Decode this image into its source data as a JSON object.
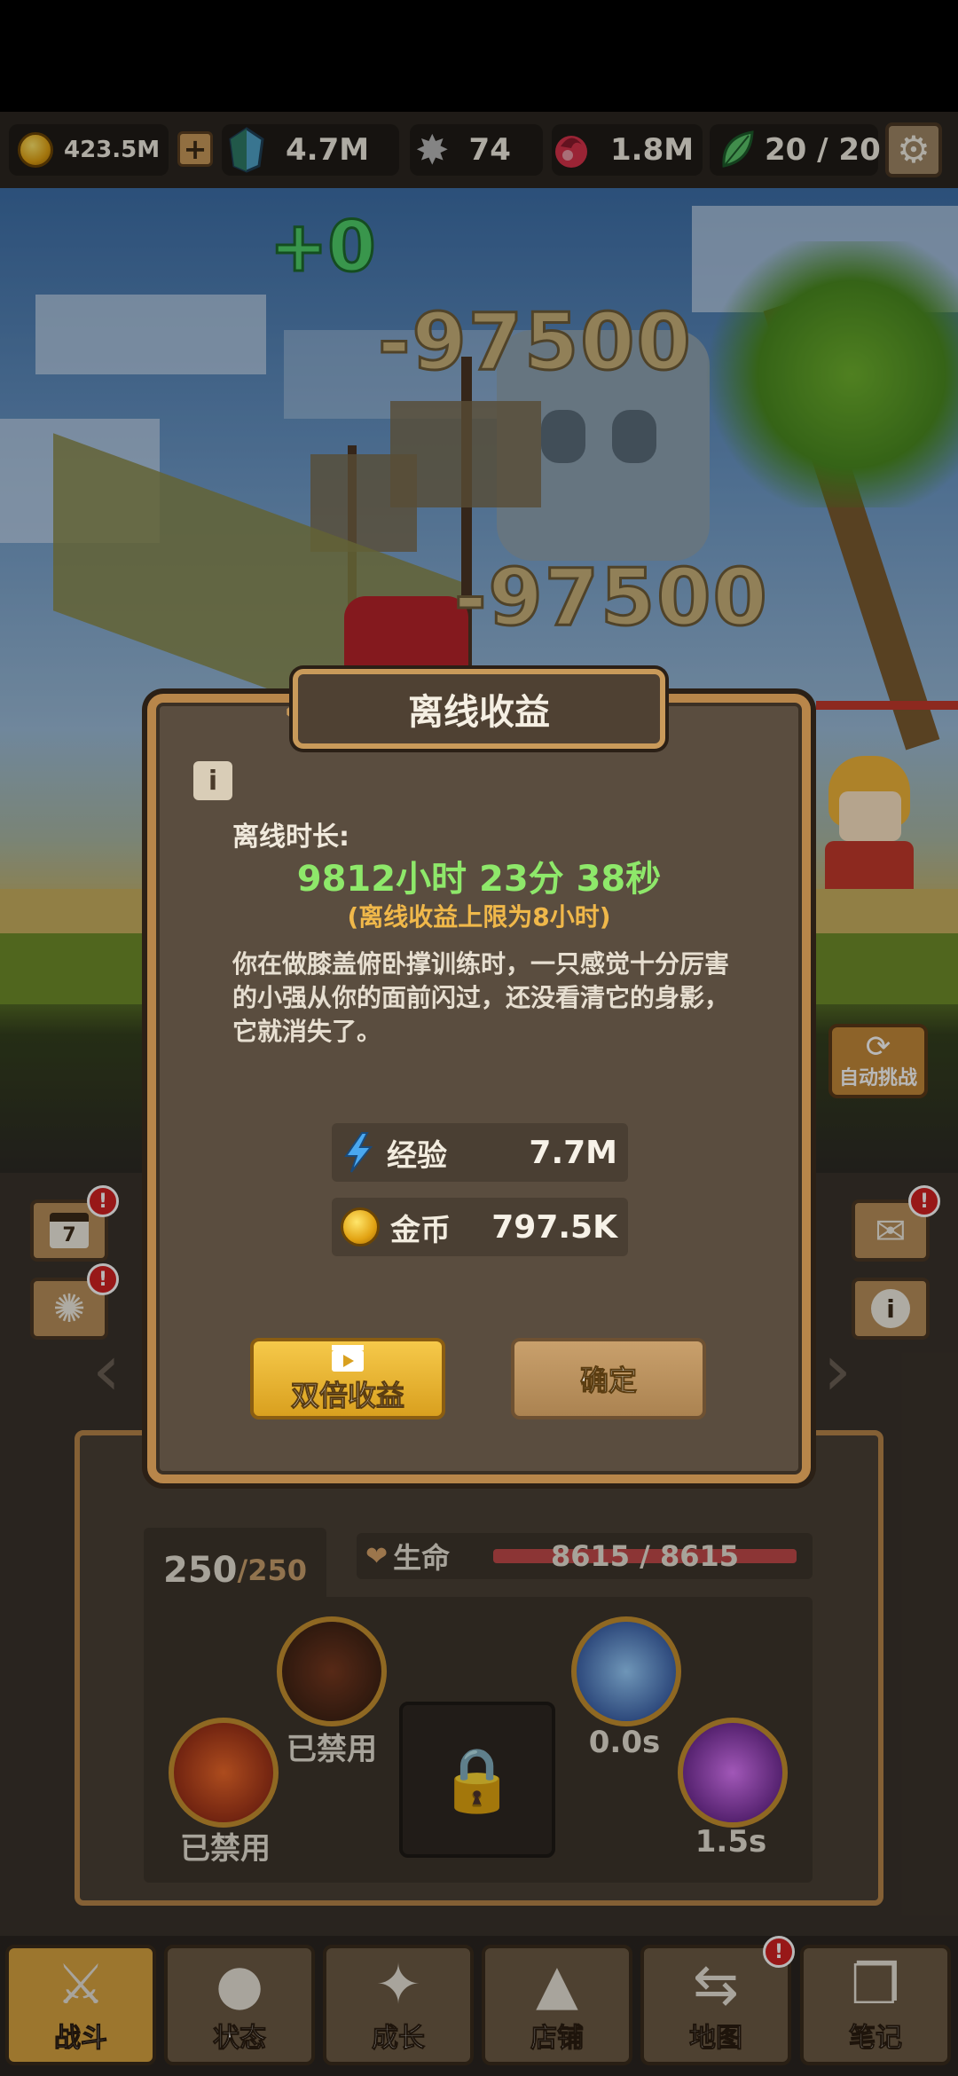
{
  "resources": {
    "gold": "423.5M",
    "add_symbol": "+",
    "gem": "4.7M",
    "star": "74",
    "ruby": "1.8M",
    "energy": "20 / 20"
  },
  "scene": {
    "heal_text": "+0",
    "damage_1": "-97500",
    "damage_2": "-97500",
    "auto_challenge": "自动挑战"
  },
  "side_buttons": {
    "calendar_day": "7",
    "badge": "!"
  },
  "stats": {
    "level_current": "250",
    "level_max": "/250",
    "hp_label": "生命",
    "hp_value": "8615 / 8615"
  },
  "skills": [
    {
      "label": "已禁用"
    },
    {
      "label": "已禁用"
    },
    {
      "label": "0.0s"
    },
    {
      "label": "1.5s"
    }
  ],
  "dialog": {
    "title": "离线收益",
    "info_symbol": "i",
    "duration_label": "离线时长:",
    "duration_value": "9812小时 23分 38秒",
    "limit_note": "(离线收益上限为8小时)",
    "story": "你在做膝盖俯卧撑训练时，一只感觉十分厉害的小强从你的面前闪过，还没看清它的身影，它就消失了。",
    "rewards": [
      {
        "name": "经验",
        "value": "7.7M",
        "icon": "lightning-icon"
      },
      {
        "name": "金币",
        "value": "797.5K",
        "icon": "coin-icon"
      }
    ],
    "double_button": "双倍收益",
    "confirm_button": "确定"
  },
  "tabs": [
    {
      "label": "战斗",
      "icon": "swords-icon"
    },
    {
      "label": "状态",
      "icon": "person-icon"
    },
    {
      "label": "成长",
      "icon": "sparkle-icon"
    },
    {
      "label": "店铺",
      "icon": "tent-icon"
    },
    {
      "label": "地图",
      "icon": "signpost-icon"
    },
    {
      "label": "笔记",
      "icon": "book-icon"
    }
  ],
  "colors": {
    "accent_gold": "#d9a440",
    "exp_green": "#8ee86a",
    "limit_orange": "#f0b84a"
  }
}
